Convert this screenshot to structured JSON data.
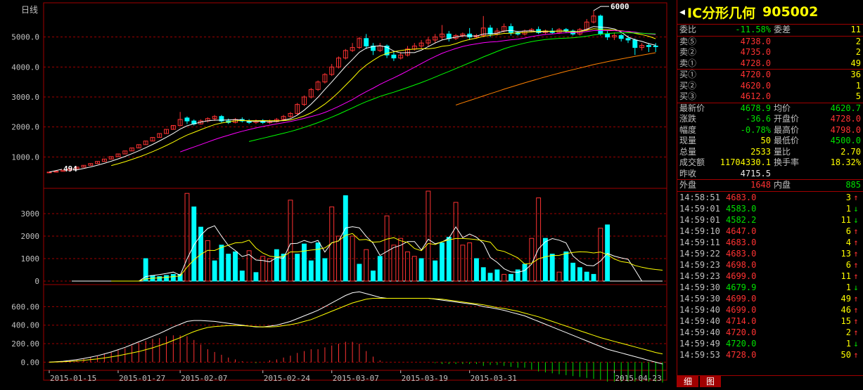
{
  "chart": {
    "period_label": "日线",
    "peak_label": "6000",
    "low_label": "494",
    "price_axis": [
      "5000.0",
      "4000.0",
      "3000.0",
      "2000.0",
      "1000.0"
    ],
    "volume_axis": [
      "3000",
      "2000",
      "1000",
      "0"
    ],
    "macd_axis": [
      "600.00",
      "400.00",
      "200.00",
      "0.00"
    ],
    "date_labels": [
      "2015-01-15",
      "2015-01-27",
      "2015-02-07",
      "2015-02-24",
      "2015-03-07",
      "2015-03-19",
      "2015-03-31",
      "2015-04-23"
    ],
    "colors": {
      "up": "#ff3232",
      "down": "#00ffff",
      "grid": "#a00000",
      "ma5": "#ffffff",
      "ma10": "#ffff00",
      "ma20": "#ff00ff",
      "ma30": "#00ff00",
      "ma60": "#ff8000"
    }
  },
  "chart_data": {
    "type": "candlestick",
    "price_ylim": [
      0,
      6000
    ],
    "candles": [
      [
        494,
        494,
        494,
        494
      ],
      [
        494,
        520,
        494,
        520
      ],
      [
        520,
        560,
        520,
        560
      ],
      [
        560,
        610,
        560,
        610
      ],
      [
        610,
        660,
        610,
        660
      ],
      [
        660,
        720,
        660,
        720
      ],
      [
        720,
        780,
        720,
        780
      ],
      [
        780,
        850,
        780,
        850
      ],
      [
        850,
        930,
        850,
        930
      ],
      [
        930,
        1010,
        930,
        1010
      ],
      [
        1010,
        1100,
        1010,
        1100
      ],
      [
        1100,
        1200,
        1100,
        1200
      ],
      [
        1200,
        1300,
        1200,
        1300
      ],
      [
        1300,
        1410,
        1300,
        1410
      ],
      [
        1410,
        1530,
        1410,
        1530
      ],
      [
        1530,
        1650,
        1530,
        1650
      ],
      [
        1650,
        1780,
        1650,
        1780
      ],
      [
        1780,
        1920,
        1780,
        1920
      ],
      [
        1920,
        2050,
        1920,
        2050
      ],
      [
        2050,
        2250,
        2040,
        2500
      ],
      [
        2300,
        2200,
        2100,
        2350
      ],
      [
        2200,
        2100,
        2050,
        2250
      ],
      [
        2100,
        2200,
        2080,
        2250
      ],
      [
        2200,
        2280,
        2150,
        2320
      ],
      [
        2280,
        2350,
        2200,
        2400
      ],
      [
        2350,
        2200,
        2150,
        2400
      ],
      [
        2200,
        2150,
        2100,
        2280
      ],
      [
        2150,
        2250,
        2120,
        2300
      ],
      [
        2250,
        2200,
        2150,
        2320
      ],
      [
        2200,
        2150,
        2100,
        2260
      ],
      [
        2150,
        2200,
        2100,
        2250
      ],
      [
        2200,
        2150,
        2100,
        2260
      ],
      [
        2150,
        2180,
        2100,
        2250
      ],
      [
        2180,
        2250,
        2150,
        2300
      ],
      [
        2250,
        2350,
        2200,
        2400
      ],
      [
        2350,
        2450,
        2300,
        2500
      ],
      [
        2450,
        2750,
        2400,
        2800
      ],
      [
        2750,
        3000,
        2700,
        3050
      ],
      [
        3000,
        3250,
        2950,
        3300
      ],
      [
        3250,
        3500,
        3200,
        3550
      ],
      [
        3500,
        3750,
        3450,
        3800
      ],
      [
        3750,
        4000,
        3700,
        4100
      ],
      [
        4000,
        4300,
        3950,
        4350
      ],
      [
        4300,
        4550,
        4250,
        4600
      ],
      [
        4550,
        4650,
        4500,
        4800
      ],
      [
        4650,
        4950,
        4600,
        5000
      ],
      [
        4950,
        4700,
        4600,
        5100
      ],
      [
        4700,
        4550,
        4400,
        4800
      ],
      [
        4550,
        4700,
        4500,
        4800
      ],
      [
        4700,
        4400,
        4300,
        4750
      ],
      [
        4400,
        4300,
        4200,
        4500
      ],
      [
        4300,
        4400,
        4250,
        4500
      ],
      [
        4400,
        4600,
        4350,
        4700
      ],
      [
        4600,
        4700,
        4550,
        4800
      ],
      [
        4700,
        4800,
        4600,
        4900
      ],
      [
        4800,
        4900,
        4700,
        5000
      ],
      [
        4900,
        5000,
        4800,
        5100
      ],
      [
        5000,
        5100,
        4900,
        5400
      ],
      [
        5100,
        4950,
        4850,
        5200
      ],
      [
        4950,
        5050,
        4900,
        5100
      ],
      [
        5050,
        5100,
        5000,
        5150
      ],
      [
        5100,
        5000,
        4900,
        5300
      ],
      [
        5000,
        5050,
        4950,
        5100
      ],
      [
        5050,
        5300,
        5000,
        5700
      ],
      [
        5300,
        5100,
        5000,
        5400
      ],
      [
        5100,
        5200,
        5050,
        5300
      ],
      [
        5200,
        5350,
        5150,
        5450
      ],
      [
        5350,
        5150,
        5050,
        5450
      ],
      [
        5150,
        5100,
        5050,
        5200
      ],
      [
        5100,
        5200,
        5050,
        5250
      ],
      [
        5200,
        5250,
        5150,
        5300
      ],
      [
        5250,
        5150,
        5100,
        5350
      ],
      [
        5150,
        5200,
        5100,
        5250
      ],
      [
        5200,
        5150,
        5100,
        5300
      ],
      [
        5150,
        5250,
        5100,
        5300
      ],
      [
        5250,
        5200,
        5150,
        5300
      ],
      [
        5200,
        5100,
        5050,
        5250
      ],
      [
        5100,
        5250,
        5050,
        5300
      ],
      [
        5250,
        5500,
        5200,
        5600
      ],
      [
        5500,
        5700,
        5450,
        5880
      ],
      [
        5700,
        5100,
        5050,
        5750
      ],
      [
        5100,
        5000,
        4900,
        5200
      ],
      [
        5000,
        5050,
        4900,
        5150
      ],
      [
        5050,
        4950,
        4850,
        5100
      ],
      [
        4950,
        4900,
        4800,
        5050
      ],
      [
        4900,
        4650,
        4400,
        4950
      ],
      [
        4650,
        4720,
        4550,
        4800
      ],
      [
        4720,
        4680,
        4500,
        4800
      ],
      [
        4700,
        4679,
        4500,
        4798
      ]
    ],
    "volume_ylim": [
      0,
      4000
    ],
    "volumes": [
      0,
      0,
      0,
      0,
      0,
      0,
      0,
      0,
      0,
      0,
      0,
      0,
      0,
      0,
      1000,
      250,
      200,
      250,
      300,
      300,
      3900,
      3300,
      2400,
      1800,
      900,
      1600,
      1200,
      1300,
      450,
      1350,
      380,
      1100,
      1000,
      1400,
      1200,
      3600,
      1200,
      1650,
      900,
      1700,
      1000,
      3300,
      2000,
      3800,
      2000,
      750,
      1400,
      450,
      1100,
      2900,
      1600,
      1900,
      1300,
      1100,
      1000,
      4000,
      900,
      1700,
      1950,
      3500,
      1600,
      1700,
      1000,
      600,
      350,
      500,
      300,
      300,
      500,
      750,
      1900,
      3700,
      1900,
      1200,
      400,
      1300,
      800,
      600,
      400,
      300,
      2350,
      2500,
      0,
      0,
      0,
      0,
      0,
      0,
      0,
      0
    ],
    "volume_up": [
      true,
      true,
      true,
      true,
      true,
      true,
      true,
      true,
      true,
      true,
      true,
      true,
      true,
      true,
      false,
      false,
      false,
      false,
      false,
      false,
      true,
      false,
      false,
      true,
      false,
      false,
      false,
      false,
      false,
      true,
      false,
      true,
      true,
      false,
      false,
      true,
      false,
      false,
      false,
      false,
      false,
      true,
      true,
      false,
      true,
      false,
      true,
      false,
      false,
      true,
      true,
      true,
      true,
      true,
      false,
      true,
      false,
      false,
      false,
      true,
      true,
      true,
      false,
      false,
      false,
      false,
      true,
      false,
      false,
      false,
      true,
      true,
      false,
      false,
      true,
      false,
      false,
      false,
      false,
      false,
      true,
      false,
      true,
      true,
      true,
      true,
      true,
      true,
      true,
      true
    ],
    "macd_ylim": [
      -50,
      800
    ],
    "dif": [
      0,
      5,
      10,
      18,
      28,
      40,
      55,
      70,
      90,
      110,
      135,
      160,
      190,
      220,
      250,
      280,
      310,
      345,
      380,
      410,
      440,
      450,
      450,
      445,
      440,
      430,
      420,
      410,
      400,
      390,
      380,
      380,
      390,
      400,
      420,
      440,
      470,
      500,
      530,
      560,
      600,
      640,
      680,
      720,
      750,
      760,
      740,
      720,
      700,
      690,
      690,
      690,
      690,
      690,
      690,
      690,
      680,
      670,
      660,
      650,
      640,
      630,
      620,
      600,
      590,
      575,
      560,
      540,
      520,
      500,
      470,
      440,
      410,
      380,
      350,
      320,
      290,
      260,
      230,
      200,
      170,
      140,
      120,
      100,
      80,
      60,
      40,
      20,
      0,
      -20
    ],
    "dea": [
      0,
      2,
      5,
      9,
      14,
      20,
      28,
      36,
      46,
      57,
      70,
      84,
      100,
      115,
      135,
      155,
      180,
      205,
      235,
      265,
      300,
      330,
      355,
      375,
      385,
      390,
      395,
      395,
      395,
      390,
      385,
      380,
      380,
      385,
      395,
      405,
      420,
      440,
      460,
      490,
      520,
      550,
      580,
      610,
      640,
      660,
      680,
      690,
      690,
      690,
      690,
      690,
      690,
      690,
      690,
      690,
      685,
      680,
      670,
      660,
      650,
      640,
      630,
      620,
      605,
      590,
      580,
      565,
      550,
      530,
      510,
      490,
      465,
      440,
      415,
      390,
      365,
      340,
      315,
      290,
      265,
      245,
      225,
      205,
      185,
      165,
      145,
      125,
      105,
      90
    ]
  },
  "quote": {
    "name": "IC分形几何",
    "code": "905002",
    "ratio_label": "委比",
    "ratio": "-11.58%",
    "diff_label": "委差",
    "diff": "11",
    "sell": [
      {
        "label": "卖⑤",
        "price": "4738.0",
        "vol": "2"
      },
      {
        "label": "卖②",
        "price": "4735.0",
        "vol": "2"
      },
      {
        "label": "卖①",
        "price": "4728.0",
        "vol": "49"
      }
    ],
    "buy": [
      {
        "label": "买①",
        "price": "4720.0",
        "vol": "36"
      },
      {
        "label": "买②",
        "price": "4620.0",
        "vol": "1"
      },
      {
        "label": "买③",
        "price": "4612.0",
        "vol": "5"
      }
    ],
    "stats": [
      {
        "l1": "最新价",
        "v1": "4678.9",
        "c1": "green",
        "l2": "均价",
        "v2": "4620.7",
        "c2": "green"
      },
      {
        "l1": "涨跌",
        "v1": "-36.6",
        "c1": "green",
        "l2": "开盘价",
        "v2": "4728.0",
        "c2": "red"
      },
      {
        "l1": "幅度",
        "v1": "-0.78%",
        "c1": "green",
        "l2": "最高价",
        "v2": "4798.0",
        "c2": "red"
      },
      {
        "l1": "现量",
        "v1": "50",
        "c1": "yellow",
        "l2": "最低价",
        "v2": "4500.0",
        "c2": "green"
      },
      {
        "l1": "总量",
        "v1": "2533",
        "c1": "yellow",
        "l2": "量比",
        "v2": "2.70",
        "c2": "yellow"
      },
      {
        "l1": "成交额",
        "v1": "11704330.1",
        "c1": "yellow",
        "l2": "换手率",
        "v2": "18.32%",
        "c2": "yellow"
      },
      {
        "l1": "昨收",
        "v1": "4715.5",
        "c1": "white",
        "l2": "",
        "v2": "",
        "c2": "white"
      }
    ],
    "outer_label": "外盘",
    "outer": "1648",
    "inner_label": "内盘",
    "inner": "885",
    "ticks": [
      {
        "time": "14:58:51",
        "price": "4683.0",
        "vol": "3",
        "dir": "up"
      },
      {
        "time": "14:59:01",
        "price": "4583.0",
        "vol": "1",
        "dir": "down"
      },
      {
        "time": "14:59:01",
        "price": "4582.2",
        "vol": "11",
        "dir": "down"
      },
      {
        "time": "14:59:10",
        "price": "4647.0",
        "vol": "6",
        "dir": "up"
      },
      {
        "time": "14:59:11",
        "price": "4683.0",
        "vol": "4",
        "dir": "up"
      },
      {
        "time": "14:59:22",
        "price": "4683.0",
        "vol": "13",
        "dir": "up"
      },
      {
        "time": "14:59:23",
        "price": "4698.0",
        "vol": "6",
        "dir": "up"
      },
      {
        "time": "14:59:23",
        "price": "4699.0",
        "vol": "11",
        "dir": "up"
      },
      {
        "time": "14:59:30",
        "price": "4679.9",
        "vol": "1",
        "dir": "down"
      },
      {
        "time": "14:59:30",
        "price": "4699.0",
        "vol": "49",
        "dir": "up"
      },
      {
        "time": "14:59:40",
        "price": "4699.0",
        "vol": "46",
        "dir": "up"
      },
      {
        "time": "14:59:40",
        "price": "4714.0",
        "vol": "15",
        "dir": "up"
      },
      {
        "time": "14:59:40",
        "price": "4720.0",
        "vol": "2",
        "dir": "up"
      },
      {
        "time": "14:59:49",
        "price": "4720.0",
        "vol": "1",
        "dir": "down"
      },
      {
        "time": "14:59:53",
        "price": "4728.0",
        "vol": "50",
        "dir": "up"
      }
    ],
    "tabs": [
      "细",
      "图"
    ]
  }
}
